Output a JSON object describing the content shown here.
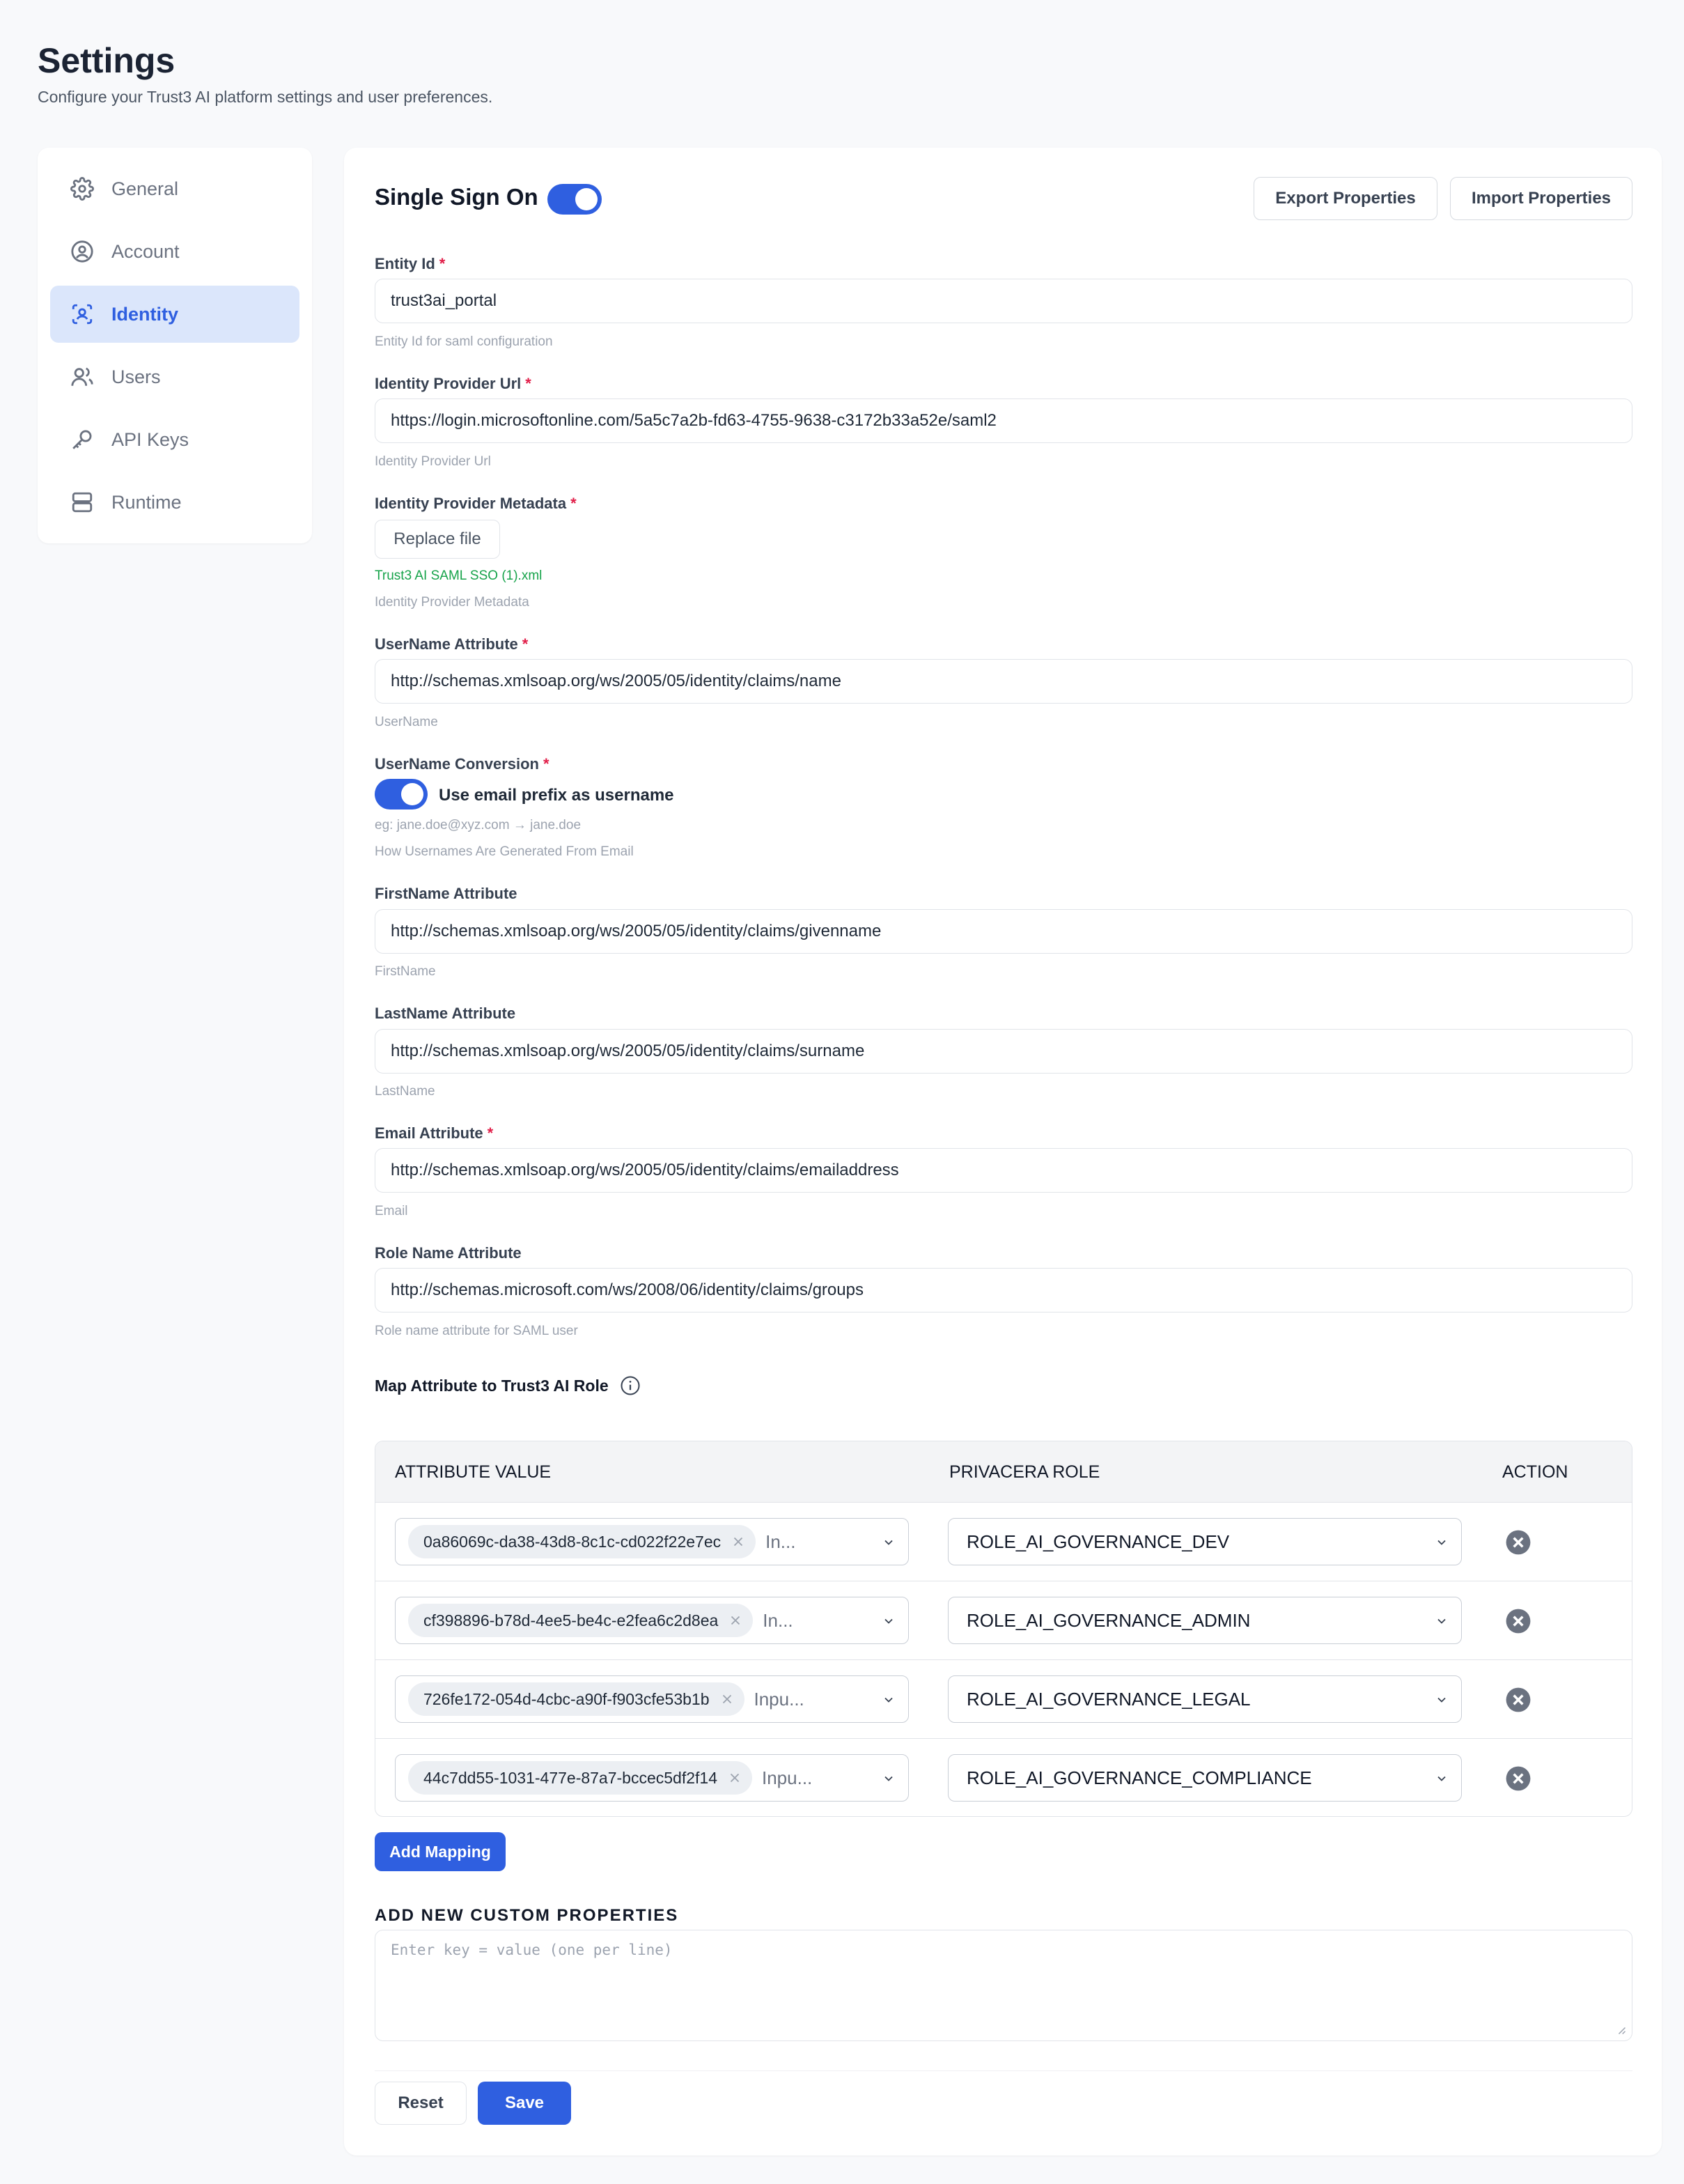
{
  "header": {
    "title": "Settings",
    "subtitle": "Configure your Trust3 AI platform settings and user preferences."
  },
  "sidebar": {
    "items": [
      {
        "label": "General",
        "icon": "gear-icon"
      },
      {
        "label": "Account",
        "icon": "user-circle-icon"
      },
      {
        "label": "Identity",
        "icon": "identity-scan-icon",
        "active": true
      },
      {
        "label": "Users",
        "icon": "users-icon"
      },
      {
        "label": "API Keys",
        "icon": "key-icon"
      },
      {
        "label": "Runtime",
        "icon": "server-icon"
      }
    ]
  },
  "sso": {
    "title": "Single Sign On",
    "enabled": true,
    "export_label": "Export Properties",
    "import_label": "Import Properties"
  },
  "fields": {
    "entity_id": {
      "label": "Entity Id",
      "value": "trust3ai_portal",
      "help": "Entity Id for saml configuration"
    },
    "idp_url": {
      "label": "Identity Provider Url",
      "value": "https://login.microsoftonline.com/5a5c7a2b-fd63-4755-9638-c3172b33a52e/saml2",
      "help": "Identity Provider Url"
    },
    "idp_metadata": {
      "label": "Identity Provider Metadata",
      "button": "Replace file",
      "file": "Trust3 AI SAML SSO (1).xml",
      "help": "Identity Provider Metadata"
    },
    "username_attr": {
      "label": "UserName Attribute",
      "value": "http://schemas.xmlsoap.org/ws/2005/05/identity/claims/name",
      "help": "UserName"
    },
    "username_conv": {
      "label": "UserName Conversion",
      "toggle_label": "Use email prefix as username",
      "example": "eg: jane.doe@xyz.com → jane.doe",
      "help": "How Usernames Are Generated From Email",
      "enabled": true
    },
    "firstname_attr": {
      "label": "FirstName Attribute",
      "value": "http://schemas.xmlsoap.org/ws/2005/05/identity/claims/givenname",
      "help": "FirstName"
    },
    "lastname_attr": {
      "label": "LastName Attribute",
      "value": "http://schemas.xmlsoap.org/ws/2005/05/identity/claims/surname",
      "help": "LastName"
    },
    "email_attr": {
      "label": "Email Attribute",
      "value": "http://schemas.xmlsoap.org/ws/2005/05/identity/claims/emailaddress",
      "help": "Email"
    },
    "role_attr": {
      "label": "Role Name Attribute",
      "value": "http://schemas.microsoft.com/ws/2008/06/identity/claims/groups",
      "help": "Role name attribute for SAML user"
    }
  },
  "mapping": {
    "title": "Map Attribute to Trust3 AI Role",
    "headers": {
      "attr": "ATTRIBUTE VALUE",
      "role": "PRIVACERA ROLE",
      "action": "ACTION"
    },
    "rows": [
      {
        "tag": "0a86069c-da38-43d8-8c1c-cd022f22e7ec",
        "placeholder": "In...",
        "role": "ROLE_AI_GOVERNANCE_DEV"
      },
      {
        "tag": "cf398896-b78d-4ee5-be4c-e2fea6c2d8ea",
        "placeholder": "In...",
        "role": "ROLE_AI_GOVERNANCE_ADMIN"
      },
      {
        "tag": "726fe172-054d-4cbc-a90f-f903cfe53b1b",
        "placeholder": "Inpu...",
        "role": "ROLE_AI_GOVERNANCE_LEGAL"
      },
      {
        "tag": "44c7dd55-1031-477e-87a7-bccec5df2f14",
        "placeholder": "Inpu...",
        "role": "ROLE_AI_GOVERNANCE_COMPLIANCE"
      }
    ],
    "add_label": "Add Mapping"
  },
  "custom": {
    "title": "ADD NEW CUSTOM PROPERTIES",
    "placeholder": "Enter key = value (one per line)"
  },
  "footer": {
    "reset_label": "Reset",
    "save_label": "Save"
  },
  "colors": {
    "accent": "#2f5fe0",
    "active_bg": "#dbe6fb",
    "required": "#e11d48",
    "success": "#16a34a"
  }
}
